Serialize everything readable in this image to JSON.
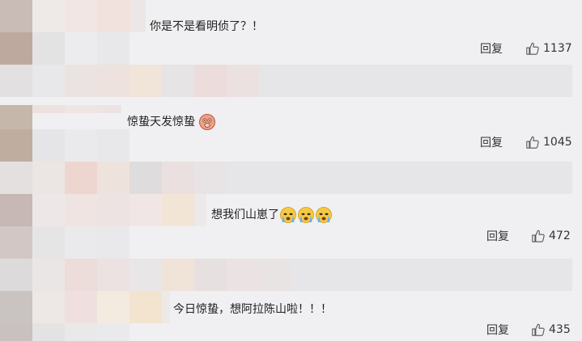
{
  "comments": [
    {
      "text": "你是不是看明侦了？！",
      "emoji": [],
      "reply_label": "回复",
      "likes": "1137"
    },
    {
      "text": "惊蛰天发惊蛰",
      "emoji": [
        "monkey-face-icon"
      ],
      "reply_label": "回复",
      "likes": "1045"
    },
    {
      "text": "想我们山崽了",
      "emoji": [
        "crying-face-icon",
        "crying-face-icon",
        "crying-face-icon"
      ],
      "reply_label": "回复",
      "likes": "472"
    },
    {
      "text": "今日惊蛰，想阿拉陈山啦！！！",
      "emoji": [],
      "reply_label": "回复",
      "likes": "435"
    }
  ],
  "colors": {
    "background": "#f0f0f2",
    "text": "#222222",
    "meta_text": "#333333"
  }
}
